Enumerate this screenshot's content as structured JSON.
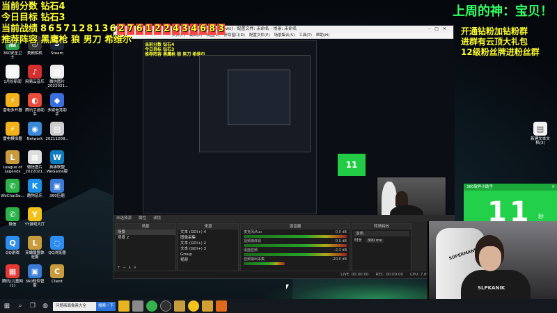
{
  "overlay": {
    "line1": "当前分数 钻石4",
    "line2": "今日目标 钻石3",
    "line3_label": "当前战绩",
    "line3_digits": [
      "8",
      "6",
      "5",
      "7",
      "1",
      "2",
      "8",
      "1",
      "3",
      "6",
      "2",
      "7",
      "6",
      "1",
      "2",
      "2",
      "4",
      "3",
      "4",
      "6",
      "8",
      "3"
    ],
    "line3_highlight_from": 10,
    "line4": "推荐阵容 黑鹰枪 狼 男刀 希维尔",
    "god": "上周的神：宝贝！",
    "right_lines": [
      "开通钻粉加钻粉群",
      "进群有云顶大礼包",
      "12级粉丝牌进粉丝群"
    ]
  },
  "desktop_icons": [
    {
      "label": "360安全卫士",
      "color": "#2aa14b",
      "glyph": "盾",
      "icon": "shield-icon"
    },
    {
      "label": "美颜相机",
      "color": "#333",
      "glyph": "◎",
      "icon": "camera-icon"
    },
    {
      "label": "Steam",
      "color": "#1b2838",
      "glyph": "S",
      "icon": "steam-icon"
    },
    {
      "label": "1月份新闻",
      "color": "#f5f5f5",
      "glyph": "▤",
      "icon": "file-icon"
    },
    {
      "label": "网易云音乐",
      "color": "#d42e2e",
      "glyph": "♪",
      "icon": "music-icon"
    },
    {
      "label": "微信图片_2022021...",
      "color": "#eeeeee",
      "glyph": "▦",
      "icon": "image-icon"
    },
    {
      "label": "雷电多开器",
      "color": "#f3b21c",
      "glyph": "⚡",
      "icon": "lightning-icon"
    },
    {
      "label": "腾讯手游助手",
      "color": "#e84b3c",
      "glyph": "◐",
      "icon": "gamepad-icon"
    },
    {
      "label": "多娱电竞助手",
      "color": "#3b6edc",
      "glyph": "◆",
      "icon": "esports-icon"
    },
    {
      "label": "雷电模拟器",
      "color": "#f3b21c",
      "glyph": "⚡",
      "icon": "emulator-icon"
    },
    {
      "label": "Network",
      "color": "#3a88d8",
      "glyph": "◉",
      "icon": "network-icon"
    },
    {
      "label": "20211208...",
      "color": "#cccccc",
      "glyph": "▤",
      "icon": "document-icon"
    },
    {
      "label": "League of Legends",
      "color": "#c89b3c",
      "glyph": "L",
      "icon": "lol-icon"
    },
    {
      "label": "微信图片_2022021...",
      "color": "#dddddd",
      "glyph": "▦",
      "icon": "image-icon"
    },
    {
      "label": "英雄联盟 WeGame版",
      "color": "#0e7bbd",
      "glyph": "W",
      "icon": "wegame-icon"
    },
    {
      "label": "WeChatSe...",
      "color": "#2bb34a",
      "glyph": "✆",
      "icon": "wechat-icon"
    },
    {
      "label": "酷狗音乐",
      "color": "#1c8fe8",
      "glyph": "K",
      "icon": "kugou-icon"
    },
    {
      "label": "360压缩",
      "color": "#3a7bd5",
      "glyph": "▣",
      "icon": "zip-icon"
    },
    {
      "label": "微信",
      "color": "#2bb34a",
      "glyph": "✆",
      "icon": "wechat-icon"
    },
    {
      "label": "YY游戏大厅",
      "color": "#f2c21b",
      "glyph": "Y",
      "icon": "yy-icon"
    },
    {
      "label": "",
      "color": "transparent",
      "glyph": "",
      "icon": "empty-icon"
    },
    {
      "label": "QQ游戏",
      "color": "#2d8cf0",
      "glyph": "Q",
      "icon": "qq-icon"
    },
    {
      "label": "英雄联盟体验服",
      "color": "#c89b3c",
      "glyph": "L",
      "icon": "lol-icon"
    },
    {
      "label": "QQ浏览器",
      "color": "#2d8cf0",
      "glyph": "◌",
      "icon": "browser-icon"
    },
    {
      "label": "腾讯(儿童网(1)",
      "color": "#e53935",
      "glyph": "▦",
      "icon": "app-icon"
    },
    {
      "label": "360软件管家",
      "color": "#3a7bd5",
      "glyph": "▣",
      "icon": "app-icon"
    },
    {
      "label": "Client",
      "color": "#c89b3c",
      "glyph": "C",
      "icon": "client-icon"
    }
  ],
  "new_doc_label": "新建文本文档(3)",
  "obs": {
    "title": "OBS 27.1.3 (64-bit, windows) - 配置文件: 未命名 - 场景: 未命名",
    "menu": [
      "文件(F)",
      "编辑(E)",
      "视图(V)",
      "停靠窗口(D)",
      "配置文件(P)",
      "场景集合(S)",
      "工具(T)",
      "帮助(H)"
    ],
    "source_label": "未选择源",
    "props_label": "属性",
    "filter_label": "滤镜",
    "scenes_title": "场景",
    "scenes": [
      "场景",
      "场景 2"
    ],
    "sources_title": "来源",
    "sources": [
      "文本 (GDI+) 4",
      "图像采集",
      "文本 (GDI+) 2",
      "文本 (GDI+) 3",
      "Group",
      "视频"
    ],
    "mixer_title": "混音器",
    "mixer": [
      {
        "name": "麦克风/Aux",
        "db": "0.0 dB"
      },
      {
        "name": "视频媒体源",
        "db": "0.0 dB"
      },
      {
        "name": "桌面音频",
        "db": "-2.3 dB"
      },
      {
        "name": "音频输出采集",
        "db": "-20.0 dB"
      }
    ],
    "transition_title": "转场特效",
    "transition": "淡出",
    "duration_label": "时长",
    "duration": "300 ms",
    "status": [
      "LIVE: 00:00:00",
      "REC: 00:00:00",
      "CPU: 7.6%, 30.00 fps"
    ]
  },
  "inner_timer": "11",
  "timer": {
    "title": "360软件小助手",
    "value": "11",
    "unit": "秒"
  },
  "shirt_text": "SLPKANIK",
  "chair_text": "SUPERMANN",
  "taskbar": {
    "search_text": "问题画面像素大全",
    "search_button": "搜索一下"
  }
}
